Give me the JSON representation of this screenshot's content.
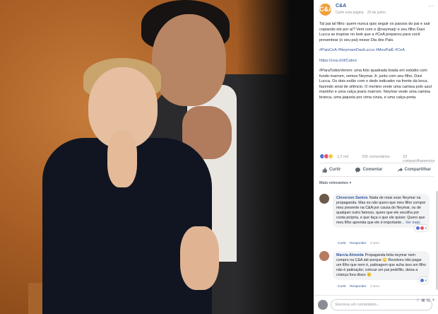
{
  "page": {
    "name": "C&A",
    "avatar_text": "C&A",
    "meta": "Curtir esta página",
    "date": "20 de junho",
    "more": "···"
  },
  "post": {
    "p1": "Tal pai tal filho: quem nunca quis seguir os passos do pai e sair copiando ele por aí? Vem com o @neymarjr e seu filho Davi Lucca se inspirar no look que a #CeA preparou para você presentear (o seu pai) nesse Dia dos Pais.",
    "hashtags": "#PaisCeA #NeymareDaviLucca #MeuPaiÉ #CeA",
    "link": "https://cea.cl/d/Cabvc",
    "p3": "#ParaTodosVerem: uma foto quadrada tirada em estúdio com fundo marrom, vemos Neymar Jr. junto com seu filho, Davi Lucca. Os dois estão com o dedo indicador na frente da boca, fazendo sinal de silêncio. O menino veste uma camisa polo azul marinho e uma calça jeans marrom. Neymar veste uma camisa branca, uma jaqueta por cima cinza, e uma calça preta."
  },
  "stats": {
    "reactions": "1,2 mil",
    "comments": "335 comentários",
    "shares": "33 compartilhamentos"
  },
  "actions": {
    "like": "Curtir",
    "comment": "Comentar",
    "share": "Compartilhar"
  },
  "filter_label": "Mais relevantes ▾",
  "comments": [
    {
      "author": "Cleverson Santos",
      "text": "Nada de mais esse Neymar na propaganda. Mas eu não quero que meu filho compre meu presente na C&A por causa do Neymar, ou de qualquer outro famoso, quero que ele escolha por conta própria, e que faça o que ele quiser. Quero que meu filho aprenda que ele é importante",
      "more": "... Ver mais",
      "react_count": "6",
      "like": "Curtir",
      "reply": "Responder",
      "time": "4 sem"
    },
    {
      "author": "Marcia Almeida",
      "text": "Propaganda feita neymar nem compro na C&A até porque 🙄 Resolveu não pagar um filho que nem é, patinagem que acha isso um filho não é patinação; colocar um pai pedófilo, deixa a criança fora disso 🙂",
      "react_count": "6",
      "like": "Curtir",
      "reply": "Responder",
      "time": "4 sem"
    }
  ],
  "writer": {
    "placeholder": "Escreva um comentário...",
    "icons": "☺ ▣ ▤ ✦"
  }
}
